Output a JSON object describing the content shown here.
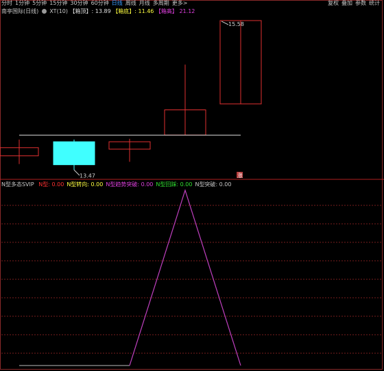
{
  "toolbar": {
    "timeframes": [
      "分时",
      "1分钟",
      "5分钟",
      "15分钟",
      "30分钟",
      "60分钟",
      "日线",
      "周线",
      "月线",
      "多周期",
      "更多>"
    ],
    "active_timeframe": "日线",
    "right_items": [
      "复权",
      "叠加",
      "参数",
      "统计"
    ]
  },
  "info": {
    "stock": "南亭国际(日线)",
    "indicator": "XT(10)",
    "box_top_label": "【箱顶】",
    "box_top_value": ": 13.89",
    "box_bottom_label": "【箱底】",
    "box_bottom_value": ": 11.46",
    "box_mid_label": "【箱高】",
    "box_mid_value": "21.12"
  },
  "indicator_header": {
    "name": "N型多态SVIP",
    "items": [
      {
        "label": "N型",
        "value": "0.00",
        "color": "#ff3030"
      },
      {
        "label": "N型转向",
        "value": "0.00",
        "color": "#ffff40"
      },
      {
        "label": "N型趋势突破",
        "value": "0.00",
        "color": "#e040e0"
      },
      {
        "label": "N型回踩",
        "value": "0.00",
        "color": "#30e030"
      },
      {
        "label": "N型突破",
        "value": "0.00",
        "color": "#c8c8c8"
      }
    ]
  },
  "colors": {
    "up": "#e03030",
    "down": "#40ffff",
    "box_line": "#d8d8d8",
    "indicator_line": "#c040c0",
    "grid": "#7a1e1e"
  },
  "chart_data": [
    {
      "type": "candlestick",
      "candles": [
        {
          "open": 12.0,
          "close": 12.55,
          "high": 13.1,
          "low": 11.45,
          "direction": "up",
          "partial": true
        },
        {
          "open": 12.95,
          "close": 11.4,
          "high": 13.1,
          "low": 11.05,
          "direction": "down"
        },
        {
          "open": 12.45,
          "close": 12.95,
          "high": 13.15,
          "low": 11.6,
          "direction": "up"
        },
        {
          "open": 13.4,
          "close": 15.1,
          "high": 18.15,
          "low": 13.4,
          "direction": "up"
        },
        {
          "open": 15.5,
          "close": 21.12,
          "high": 21.12,
          "low": 15.5,
          "direction": "up"
        }
      ],
      "box_line_value": 13.4,
      "annotations": [
        {
          "candle": 1,
          "label": "13.47"
        },
        {
          "candle": 4,
          "label": "15.58"
        }
      ],
      "signal_marker": "涨"
    },
    {
      "type": "line",
      "name": "N型多态SVIP",
      "values": [
        0,
        0,
        0,
        0,
        1,
        0,
        0
      ],
      "ylim": [
        0,
        1
      ]
    }
  ]
}
